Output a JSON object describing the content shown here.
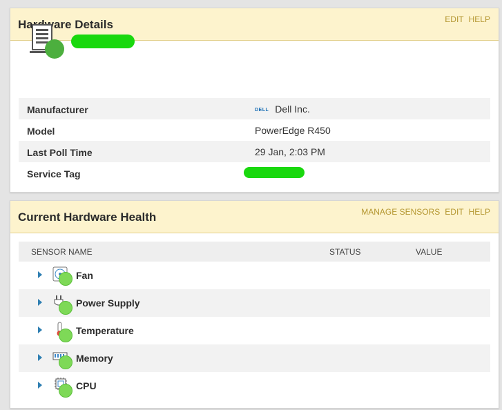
{
  "hardware_details": {
    "title": "Hardware Details",
    "actions": [
      "EDIT",
      "HELP"
    ],
    "rows": [
      {
        "label": "Manufacturer",
        "value": "Dell Inc.",
        "logo_text": "DELL"
      },
      {
        "label": "Model",
        "value": "PowerEdge R450"
      },
      {
        "label": "Last Poll Time",
        "value": "29 Jan, 2:03 PM"
      },
      {
        "label": "Service Tag",
        "value": ""
      }
    ],
    "device_icon": "server-icon",
    "status_color": "#4caf3e"
  },
  "hardware_health": {
    "title": "Current Hardware Health",
    "actions": [
      "MANAGE SENSORS",
      "EDIT",
      "HELP"
    ],
    "columns": [
      "SENSOR NAME",
      "STATUS",
      "VALUE"
    ],
    "sensors": [
      {
        "name": "Fan",
        "icon": "fan-icon"
      },
      {
        "name": "Power Supply",
        "icon": "power-plug-icon"
      },
      {
        "name": "Temperature",
        "icon": "thermometer-icon"
      },
      {
        "name": "Memory",
        "icon": "memory-icon"
      },
      {
        "name": "CPU",
        "icon": "cpu-icon"
      }
    ],
    "status_color": "#7ed957"
  },
  "colors": {
    "header_bg": "#fdf3cd",
    "action_link": "#b49630",
    "expand_caret": "#2f7fb2",
    "redaction": "#19d80e"
  }
}
